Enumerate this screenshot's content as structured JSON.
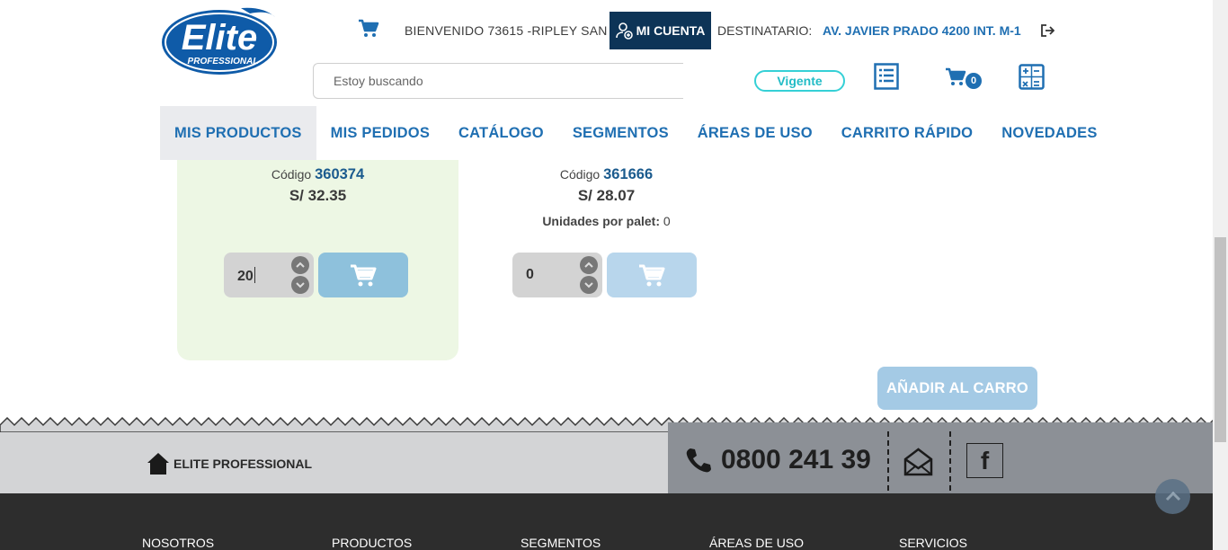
{
  "header": {
    "logo_text": "Elite",
    "logo_sub": "PROFESSIONAL",
    "welcome": "BIENVENIDO 73615 -RIPLEY SAN",
    "account_label": "MI CUENTA",
    "destinatario_label": "DESTINATARIO:",
    "destinatario_value": "AV. JAVIER PRADO 4200 INT. M-1",
    "search_placeholder": "Estoy buscando",
    "status": "Vigente",
    "cart_count": "0"
  },
  "nav": {
    "items": [
      "MIS PRODUCTOS",
      "MIS PEDIDOS",
      "CATÁLOGO",
      "SEGMENTOS",
      "ÁREAS DE USO",
      "CARRITO RÁPIDO",
      "NOVEDADES"
    ],
    "active": "MIS PRODUCTOS"
  },
  "products": [
    {
      "code_label": "Código",
      "code": "360374",
      "price": "S/ 32.35",
      "quantity": "20",
      "selected": true
    },
    {
      "code_label": "Código",
      "code": "361666",
      "price": "S/ 28.07",
      "units_label": "Unidades por palet:",
      "units_value": "0",
      "quantity": "0",
      "selected": false
    }
  ],
  "add_to_cart_label": "AÑADIR AL CARRO",
  "footer": {
    "brand": "ELITE PROFESSIONAL",
    "phone": "0800 241 39",
    "facebook": "f",
    "links": [
      "NOSOTROS",
      "PRODUCTOS",
      "SEGMENTOS",
      "ÁREAS DE USO",
      "SERVICIOS"
    ]
  },
  "colors": {
    "brand_blue": "#1f6fb2",
    "account_bg": "#0d3457",
    "selected_card": "#edf7e4",
    "add_button": "#a4cae5",
    "vigente": "#35d0d6"
  },
  "icons": [
    "cart-icon",
    "user-icon",
    "logout-icon",
    "list-icon",
    "calculator-icon",
    "home-icon",
    "phone-icon",
    "mail-icon",
    "facebook-icon",
    "chevron-up-icon",
    "chevron-down-icon"
  ]
}
